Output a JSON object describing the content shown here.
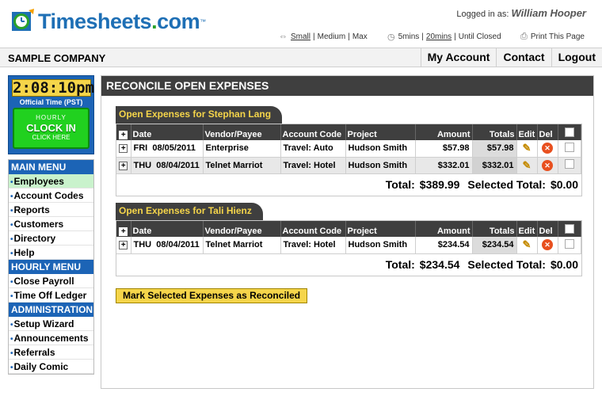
{
  "header": {
    "logo": "Timesheets.com",
    "logo_main": "Timesheets",
    "logo_dot": ".",
    "logo_tld": "com",
    "logo_tm": "™",
    "logged_in_label": "Logged in as:",
    "user_name": "William Hooper",
    "size_small": "Small",
    "size_medium": "Medium",
    "size_max": "Max",
    "time_5": "5mins",
    "time_20": "20mins",
    "time_closed": "Until Closed",
    "print": "Print This Page"
  },
  "topbar": {
    "company": "SAMPLE COMPANY",
    "nav": [
      "My Account",
      "Contact",
      "Logout"
    ]
  },
  "clock": {
    "time": "2:08:10pm",
    "official": "Official Time (PST)",
    "hourly": "HOURLY",
    "clock_in": "CLOCK IN",
    "click_here": "CLICK HERE"
  },
  "menus": {
    "main_head": "MAIN MENU",
    "main_items": [
      "Employees",
      "Account Codes",
      "Reports",
      "Customers",
      "Directory",
      "Help"
    ],
    "hourly_head": "HOURLY MENU",
    "hourly_items": [
      "Close Payroll",
      "Time Off Ledger"
    ],
    "admin_head": "ADMINISTRATION",
    "admin_items": [
      "Setup Wizard",
      "Announcements",
      "Referrals",
      "Daily Comic"
    ]
  },
  "main": {
    "title": "RECONCILE OPEN EXPENSES",
    "columns": [
      "Date",
      "Vendor/Payee",
      "Account Code",
      "Project",
      "Amount",
      "Totals",
      "Edit",
      "Del"
    ],
    "sections": [
      {
        "heading": "Open Expenses for Stephan Lang",
        "rows": [
          {
            "day": "FRI",
            "date": "08/05/2011",
            "vendor": "Enterprise",
            "account": "Travel: Auto",
            "project": "Hudson Smith",
            "amount": "$57.98",
            "totals": "$57.98"
          },
          {
            "day": "THU",
            "date": "08/04/2011",
            "vendor": "Telnet Marriot",
            "account": "Travel: Hotel",
            "project": "Hudson Smith",
            "amount": "$332.01",
            "totals": "$332.01"
          }
        ],
        "total_label": "Total:",
        "total": "$389.99",
        "selected_label": "Selected Total:",
        "selected_total": "$0.00"
      },
      {
        "heading": "Open Expenses for Tali Hienz",
        "rows": [
          {
            "day": "THU",
            "date": "08/04/2011",
            "vendor": "Telnet Marriot",
            "account": "Travel: Hotel",
            "project": "Hudson Smith",
            "amount": "$234.54",
            "totals": "$234.54"
          }
        ],
        "total_label": "Total:",
        "total": "$234.54",
        "selected_label": "Selected Total:",
        "selected_total": "$0.00"
      }
    ],
    "reconcile_button": "Mark Selected Expenses as Reconciled"
  }
}
